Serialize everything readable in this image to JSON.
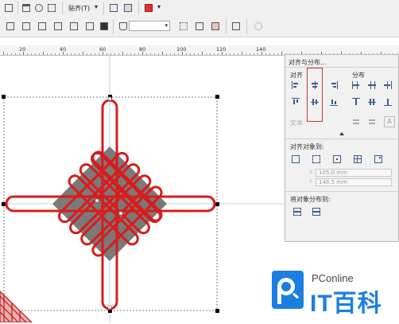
{
  "toolbar": {
    "snap_label": "贴齐(T)",
    "snap_arrow": "▾",
    "outline_field_value": ""
  },
  "ruler": {
    "labels": [
      "20",
      "40",
      "60",
      "80",
      "100",
      "120",
      "140"
    ]
  },
  "panel": {
    "title": "对齐与分布...",
    "align_label": "对齐",
    "distribute_label": "分布",
    "text_label": "文本",
    "align_to_label": "对齐对象到:",
    "x_value": "105.0 mm",
    "y_value": "148.5 mm",
    "x_axis": "X",
    "y_axis": "Y",
    "distribute_to_label": "将对象分布到:",
    "text_icon": "A"
  },
  "watermark": {
    "brand": "PConline",
    "product": "IT百科"
  },
  "colors": {
    "knot_red": "#d91b1b",
    "diamond_gray": "#7a7a7a",
    "highlight_box": "#c0392b",
    "logo_blue": "#1a7fe0"
  }
}
